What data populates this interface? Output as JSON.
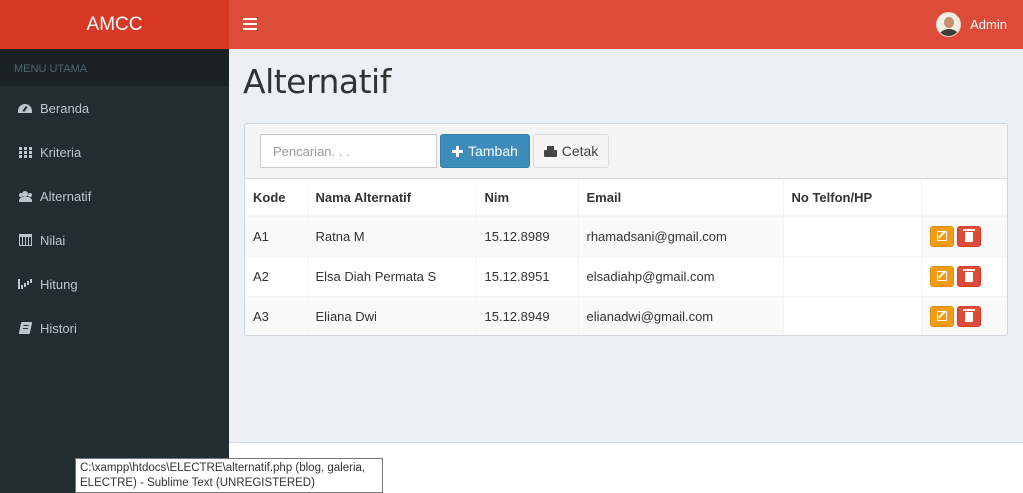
{
  "brand": {
    "name": "AMCC"
  },
  "header": {
    "user_name": "Admin"
  },
  "sidebar": {
    "header": "MENU UTAMA",
    "items": [
      {
        "label": "Beranda",
        "icon": "dashboard-icon"
      },
      {
        "label": "Kriteria",
        "icon": "grid-icon"
      },
      {
        "label": "Alternatif",
        "icon": "users-icon"
      },
      {
        "label": "Nilai",
        "icon": "calendar-icon"
      },
      {
        "label": "Hitung",
        "icon": "bar-chart-icon"
      },
      {
        "label": "Histori",
        "icon": "book-icon"
      }
    ]
  },
  "main": {
    "title": "Alternatif",
    "search": {
      "placeholder": "Pencarian. . .",
      "value": ""
    },
    "add_label": "Tambah",
    "print_label": "Cetak",
    "table": {
      "headers": [
        "Kode",
        "Nama Alternatif",
        "Nim",
        "Email",
        "No Telfon/HP"
      ],
      "rows": [
        {
          "kode": "A1",
          "nama": "Ratna M",
          "nim": "15.12.8989",
          "email": "rhamadsani@gmail.com",
          "telp": ""
        },
        {
          "kode": "A2",
          "nama": "Elsa Diah Permata S",
          "nim": "15.12.8951",
          "email": "elsadiahp@gmail.com",
          "telp": ""
        },
        {
          "kode": "A3",
          "nama": "Eliana Dwi",
          "nim": "15.12.8949",
          "email": "elianadwi@gmail.com",
          "telp": ""
        }
      ]
    }
  },
  "tooltip": {
    "line1": "C:\\xampp\\htdocs\\ELECTRE\\alternatif.php (blog, galeria,",
    "line2": "ELECTRE) - Sublime Text (UNREGISTERED)"
  },
  "colors": {
    "header_red": "#dd4b39",
    "brand_red": "#d73925",
    "sidebar_dark": "#222d32",
    "primary_blue": "#3c8dbc",
    "warning_orange": "#f39c12",
    "danger_red": "#dd4b39"
  }
}
